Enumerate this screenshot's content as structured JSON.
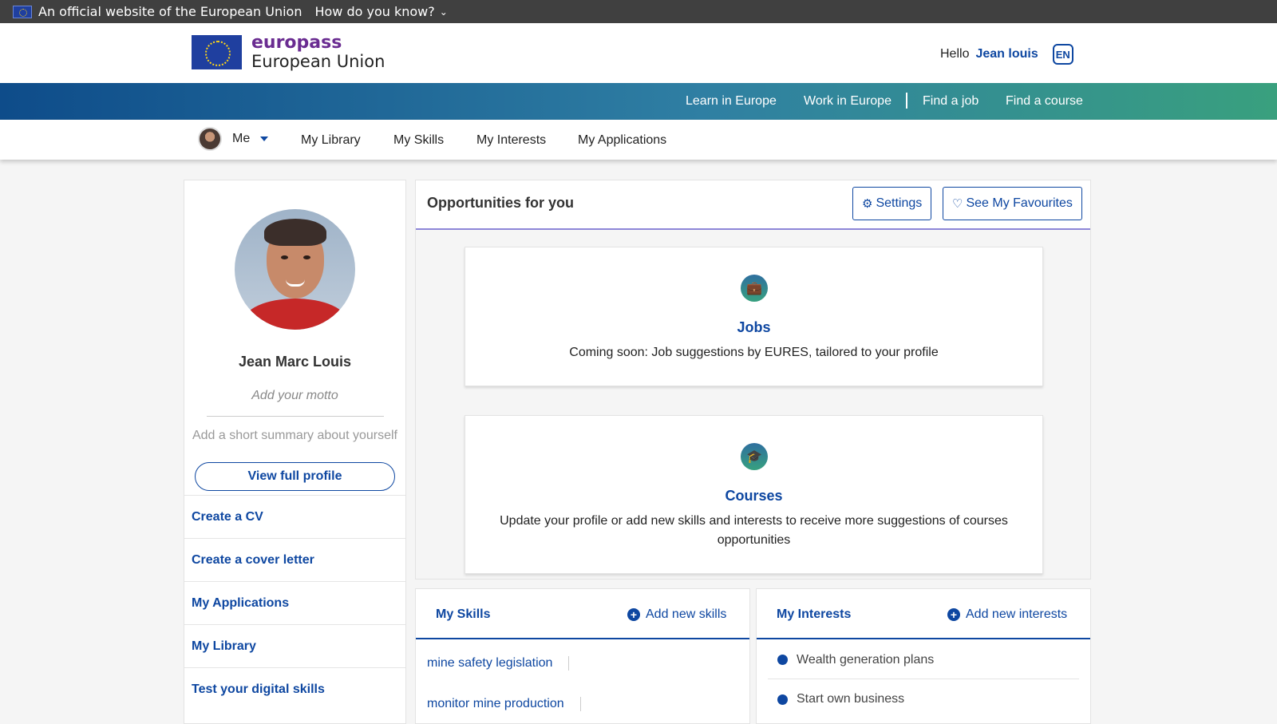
{
  "official_bar": {
    "text": "An official website of the European Union",
    "how_label": "How do you know?"
  },
  "header": {
    "brand": "europass",
    "org": "European Union",
    "hello_label": "Hello",
    "user_name": "Jean louis",
    "language": "EN"
  },
  "main_nav": {
    "items": [
      "Learn in Europe",
      "Work in Europe",
      "Find a job",
      "Find a course"
    ]
  },
  "sub_nav": {
    "me_label": "Me",
    "items": [
      "My Library",
      "My Skills",
      "My Interests",
      "My Applications"
    ]
  },
  "profile": {
    "name": "Jean Marc Louis",
    "motto_placeholder": "Add your motto",
    "summary_placeholder": "Add a short summary about yourself",
    "view_button": "View full profile",
    "links": [
      "Create a CV",
      "Create a cover letter",
      "My Applications",
      "My Library",
      "Test your digital skills"
    ]
  },
  "opportunities": {
    "title": "Opportunities for you",
    "settings_label": "Settings",
    "favourites_label": "See My Favourites",
    "jobs": {
      "title": "Jobs",
      "description": "Coming soon: Job suggestions by EURES, tailored to your profile"
    },
    "courses": {
      "title": "Courses",
      "description": "Update your profile or add new skills and interests to receive more suggestions of courses opportunities"
    }
  },
  "skills": {
    "title": "My Skills",
    "add_label": "Add new skills",
    "items": [
      "mine safety legislation",
      "monitor mine production"
    ]
  },
  "interests": {
    "title": "My Interests",
    "add_label": "Add new interests",
    "items": [
      "Wealth generation plans",
      "Start own business"
    ]
  },
  "colors": {
    "primary": "#0e47a1",
    "brand_purple": "#6a2c91",
    "official_bar": "#404040"
  }
}
